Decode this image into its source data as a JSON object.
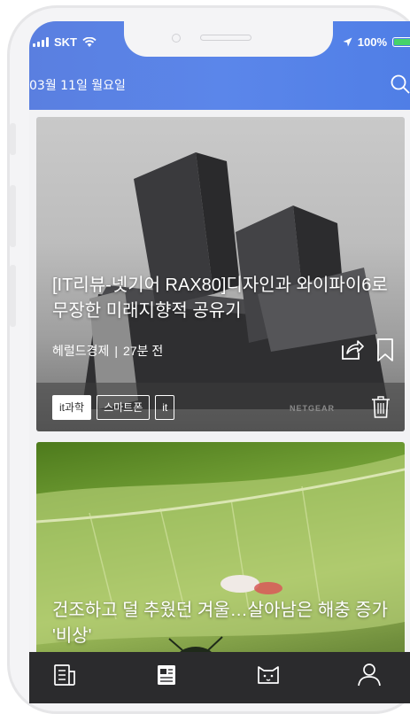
{
  "status": {
    "carrier": "SKT",
    "battery": "100%"
  },
  "header": {
    "date": "03월 11일 월요일"
  },
  "cards": [
    {
      "title": "[IT리뷰-넷기어 RAX80]디자인과 와이파이6로 무장한 미래지향적 공유기",
      "source": "헤럴드경제",
      "separator": "|",
      "time": "27분 전",
      "tags": [
        "it과학",
        "스마트폰",
        "it"
      ],
      "brand": "NETGEAR"
    },
    {
      "title": "건조하고 덜 추웠던 겨울…살아남은 해충 증가 '비상'"
    }
  ],
  "colors": {
    "header_start": "#5a7fe0",
    "header_end": "#4f7ee6",
    "tabbar": "#2b2b2d",
    "battery_fill": "#46d36a"
  },
  "tabbar_icons": [
    "news-list-icon",
    "newspaper-icon",
    "cat-icon",
    "profile-icon"
  ]
}
